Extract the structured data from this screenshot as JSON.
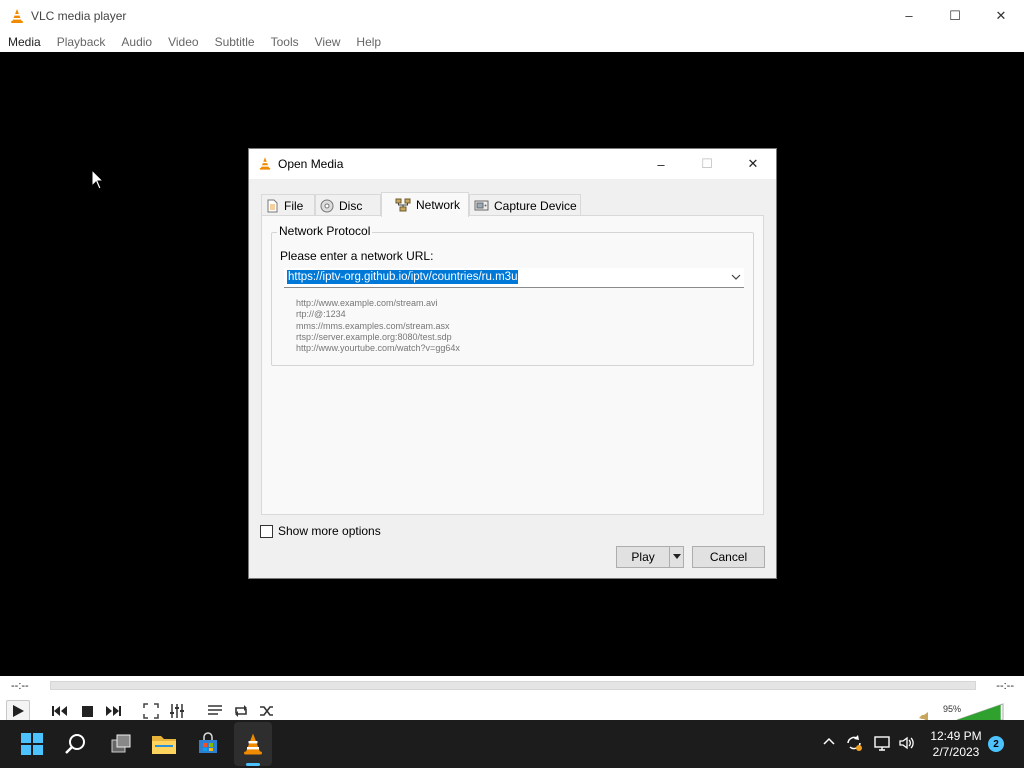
{
  "window": {
    "title": "VLC media player",
    "controls": {
      "minimize": "–",
      "maximize": "☐",
      "close": "✕"
    }
  },
  "menubar": [
    "Media",
    "Playback",
    "Audio",
    "Video",
    "Subtitle",
    "Tools",
    "View",
    "Help"
  ],
  "player": {
    "elapsed": "--:--",
    "remaining": "--:--",
    "volume": "95%",
    "volume_level": 0.95
  },
  "dialog": {
    "title": "Open Media",
    "tabs": [
      {
        "label": "File",
        "icon": "file-icon"
      },
      {
        "label": "Disc",
        "icon": "disc-icon"
      },
      {
        "label": "Network",
        "icon": "network-icon",
        "active": true
      },
      {
        "label": "Capture Device",
        "icon": "capture-device-icon"
      }
    ],
    "network_protocol": {
      "legend": "Network Protocol",
      "url_label": "Please enter a network URL:",
      "url_value": "https://iptv-org.github.io/iptv/countries/ru.m3u",
      "examples": [
        "http://www.example.com/stream.avi",
        "rtp://@:1234",
        "mms://mms.examples.com/stream.asx",
        "rtsp://server.example.org:8080/test.sdp",
        "http://www.yourtube.com/watch?v=gg64x"
      ]
    },
    "show_more_options": "Show more options",
    "show_more_checked": false,
    "play_label": "Play",
    "cancel_label": "Cancel"
  },
  "taskbar": {
    "time": "12:49 PM",
    "date": "2/7/2023",
    "notification_count": "2"
  },
  "colors": {
    "accent": "#0078d7",
    "vlc_orange": "#f08b00",
    "taskbar_bg": "#1c1c1c"
  }
}
